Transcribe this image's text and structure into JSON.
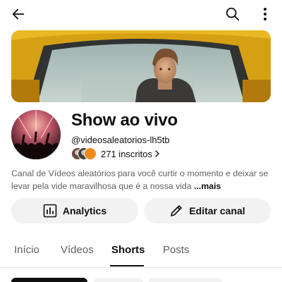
{
  "topbar": {
    "back_icon": "arrow-left-icon",
    "search_icon": "search-icon",
    "more_icon": "more-vertical-icon"
  },
  "banner": {
    "description_icon": "banner-image"
  },
  "channel": {
    "name": "Show ao vivo",
    "handle": "@videosaleatorios-lh5tb",
    "subscribers": "271 inscritos",
    "description_text": "Canal de Vídeos aleatórios para você curtir o momento e deixar se levar pela vide maravilhosa que é a nossa vida ",
    "description_more": "...mais"
  },
  "actions": {
    "analytics_label": "Analytics",
    "edit_label": "Editar canal"
  },
  "tabs": [
    {
      "label": "Início",
      "active": false
    },
    {
      "label": "Vídeos",
      "active": false
    },
    {
      "label": "Shorts",
      "active": true
    },
    {
      "label": "Posts",
      "active": false
    }
  ],
  "colors": {
    "accent": "#0f0f0f",
    "secondary_text": "#606060",
    "button_bg": "#f2f2f2",
    "banner_yellow": "#e8b21a"
  }
}
